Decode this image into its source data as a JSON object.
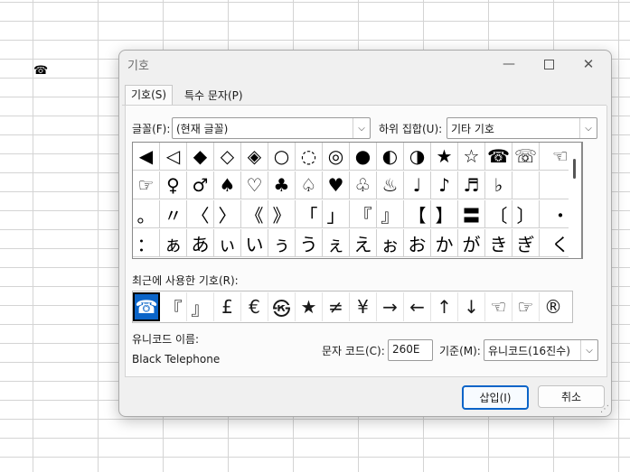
{
  "sheet": {
    "cell_symbol": "☎"
  },
  "dialog": {
    "title": "기호",
    "window_controls": {
      "minimize": "—",
      "close": "✕"
    },
    "tabs": [
      {
        "label": "기호(S)",
        "active": true
      },
      {
        "label": "특수 문자(P)",
        "active": false
      }
    ],
    "font": {
      "label": "글꼴(F):",
      "value": "(현재 글꼴)"
    },
    "subset": {
      "label": "하위 집합(U):",
      "value": "기타 기호"
    },
    "symbol_rows": [
      [
        "◀",
        "◁",
        "◆",
        "◇",
        "◈",
        "○",
        "◌",
        "◎",
        "●",
        "◐",
        "◑",
        "★",
        "☆",
        "☎",
        "☏",
        "☜"
      ],
      [
        "☞",
        "♀",
        "♂",
        "♠",
        "♡",
        "♣",
        "♤",
        "♥",
        "♧",
        "♨",
        "♩",
        "♪",
        "♬",
        "♭",
        "",
        ""
      ],
      [
        "。",
        "〃",
        "〈",
        "〉",
        "《",
        "》",
        "「",
        "」",
        "『",
        "』",
        "【",
        "】",
        "〓",
        "〔",
        "〕",
        "・"
      ],
      [
        "：",
        "ぁ",
        "あ",
        "ぃ",
        "い",
        "ぅ",
        "う",
        "ぇ",
        "え",
        "ぉ",
        "お",
        "か",
        "が",
        "き",
        "ぎ",
        "く"
      ]
    ],
    "recent": {
      "label": "최근에 사용한 기호(R):",
      "symbols": [
        "☎",
        "『",
        "』",
        "£",
        "€",
        "㉿",
        "★",
        "≠",
        "¥",
        "→",
        "←",
        "↑",
        "↓",
        "☜",
        "☞",
        "®"
      ]
    },
    "unicode_name": {
      "label": "유니코드 이름:",
      "value": "Black Telephone"
    },
    "char_code": {
      "label": "문자 코드(C):",
      "value": "260E"
    },
    "basis": {
      "label": "기준(M):",
      "value": "유니코드(16진수)"
    },
    "buttons": {
      "insert": "삽입(I)",
      "cancel": "취소"
    },
    "colors": {
      "accent": "#0a64c8",
      "dialog_bg": "#f0f0f0"
    }
  }
}
